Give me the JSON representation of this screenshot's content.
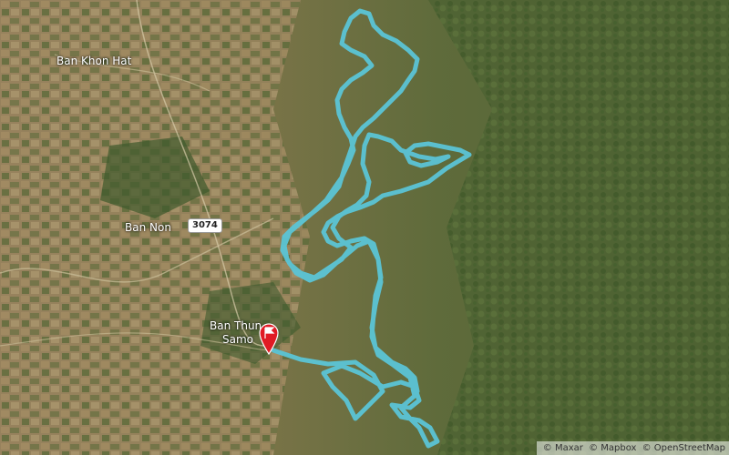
{
  "map": {
    "places": [
      {
        "id": "ban-khon-hat",
        "label": "Ban Khon Hat"
      },
      {
        "id": "ban-non",
        "label": "Ban Non"
      },
      {
        "id": "ban-thun-samo-1",
        "label": "Ban Thun"
      },
      {
        "id": "ban-thun-samo-2",
        "label": "Samo"
      }
    ],
    "road_shield": "3074",
    "route_color": "#5bc4d6",
    "marker_color": "#e01b24",
    "marker_icon": "flag-icon"
  },
  "attribution": {
    "maxar": "© Maxar",
    "mapbox": "© Mapbox",
    "osm": "© OpenStreetMap"
  }
}
